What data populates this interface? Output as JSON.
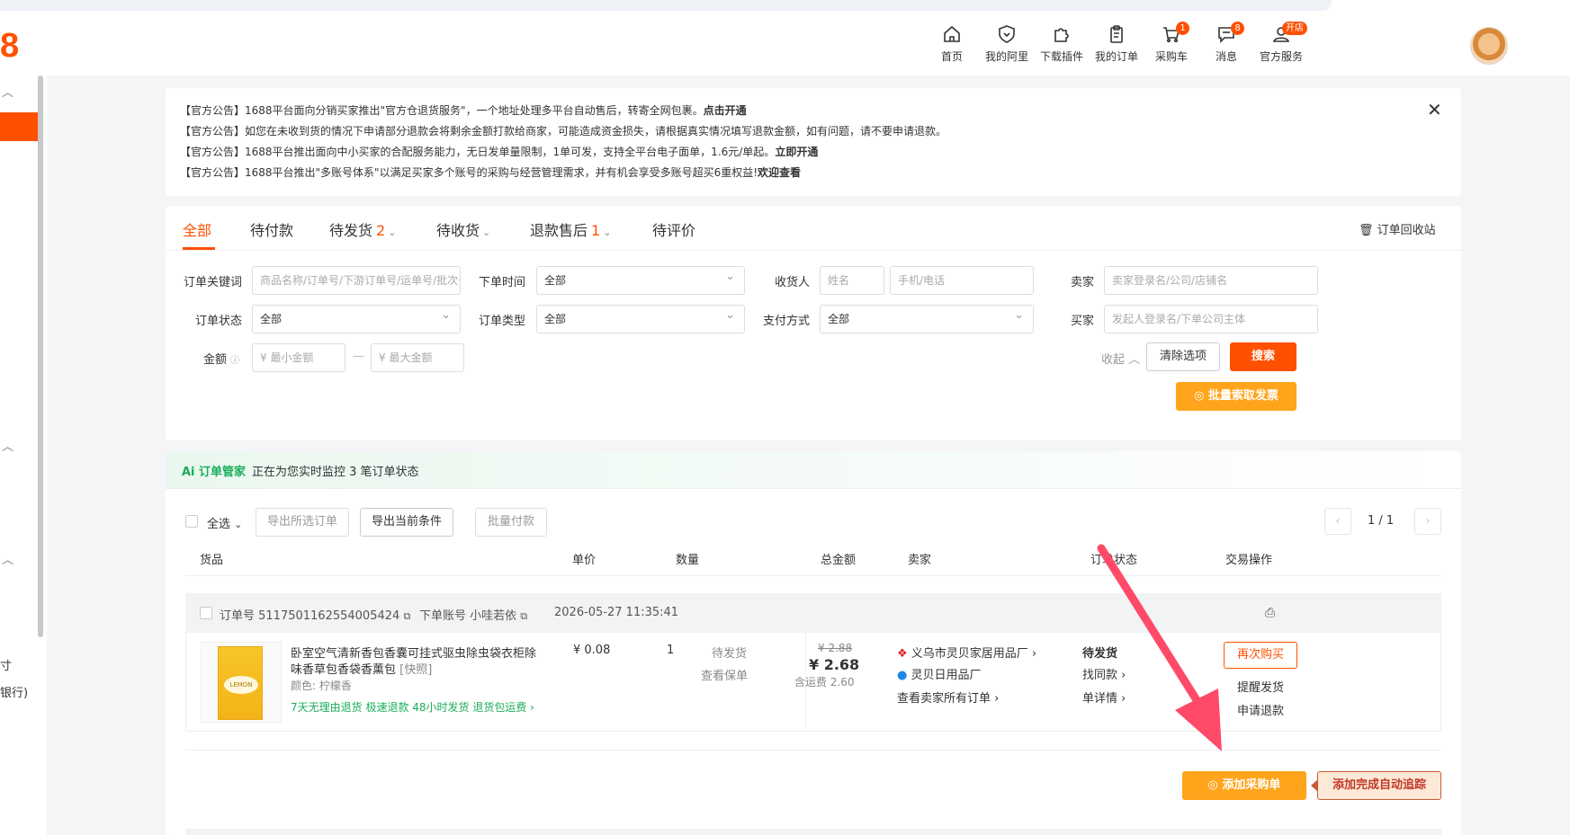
{
  "header": {
    "logo": "8",
    "nav": [
      {
        "label": "首页"
      },
      {
        "label": "我的阿里"
      },
      {
        "label": "下载插件"
      },
      {
        "label": "我的订单"
      },
      {
        "label": "采购车",
        "badge": "1"
      },
      {
        "label": "消息",
        "badge": "8"
      },
      {
        "label": "官方服务",
        "badge": "开店"
      }
    ]
  },
  "sidebar": {
    "texts": [
      "寸",
      "银行)"
    ]
  },
  "notice": {
    "lines": [
      {
        "text": "【官方公告】1688平台面向分销买家推出\"官方仓退货服务\"，一个地址处理多平台自动售后，转寄全网包裹。",
        "link": "点击开通"
      },
      {
        "text": "【官方公告】如您在未收到货的情况下申请部分退款会将剩余金额打款给商家，可能造成资金损失，请根据真实情况填写退款金额，如有问题，请不要申请退款。",
        "link": ""
      },
      {
        "text": "【官方公告】1688平台推出面向中小买家的合配服务能力，无日发单量限制，1单可发，支持全平台电子面单，1.6元/单起。",
        "link": "立即开通"
      },
      {
        "text": "【官方公告】1688平台推出\"多账号体系\"以满足买家多个账号的采购与经营管理需求，并有机会享受多账号超买6重权益!",
        "link": "欢迎查看"
      }
    ]
  },
  "tabs": [
    {
      "label": "全部",
      "count": "",
      "chev": ""
    },
    {
      "label": "待付款",
      "count": "",
      "chev": ""
    },
    {
      "label": "待发货",
      "count": "2",
      "chev": "⌄"
    },
    {
      "label": "待收货",
      "count": "",
      "chev": "⌄"
    },
    {
      "label": "退款售后",
      "count": "1",
      "chev": "⌄"
    },
    {
      "label": "待评价",
      "count": "",
      "chev": ""
    }
  ],
  "recycle": "订单回收站",
  "filters": {
    "keyword_label": "订单关键词",
    "keyword_ph": "商品名称/订单号/下游订单号/运单号/批次号",
    "time_label": "下单时间",
    "time_value": "全部",
    "receiver_label": "收货人",
    "receiver_name_ph": "姓名",
    "receiver_phone_ph": "手机/电话",
    "seller_label": "卖家",
    "seller_ph": "卖家登录名/公司/店铺名",
    "status_label": "订单状态",
    "status_value": "全部",
    "type_label": "订单类型",
    "type_value": "全部",
    "pay_label": "支付方式",
    "pay_value": "全部",
    "buyer_label": "买家",
    "buyer_ph": "发起人登录名/下单公司主体",
    "amount_label": "金额",
    "amount_min_ph": "¥  最小金额",
    "amount_max_ph": "¥  最大金额",
    "amount_sep": "—",
    "collapse": "收起",
    "clear": "清除选项",
    "search": "搜索",
    "invoice": "批量索取发票"
  },
  "ai": {
    "logo": "Ai 订单管家",
    "text": "正在为您实时监控 3 笔订单状态"
  },
  "toolbar": {
    "select_all": "全选",
    "export_selected": "导出所选订单",
    "export_current": "导出当前条件",
    "batch_pay": "批量付款",
    "page": "1 / 1"
  },
  "columns": [
    "货品",
    "单价",
    "数量",
    "总金额",
    "卖家",
    "订单状态",
    "交易操作"
  ],
  "order": {
    "order_no": "订单号 5117501162554005424",
    "account": "下单账号 小哇若依",
    "time": "2026-05-27 11:35:41",
    "title_line1": "卧室空气清新香包香囊可挂式驱虫除虫袋衣柜除",
    "title_line2": "味香草包香袋香薰包",
    "snapshot": "[快照]",
    "spec": "颜色: 柠檬香",
    "services": "7天无理由退货   极速退款   48小时发货   退货包运费  ›",
    "thumb_text": "LEMON",
    "price": "¥ 0.08",
    "qty": "1",
    "ship_status": "待发货",
    "view_policy": "查看保单",
    "original_total": "¥ 2.88",
    "total": "¥ 2.68",
    "shipping": "含运费 2.60",
    "seller_name": "义乌市灵贝家居用品厂  ›",
    "seller_shop": "灵贝日用品厂",
    "seller_all": "查看卖家所有订单  ›",
    "status": "待发货",
    "find_similar": "找同款  ›",
    "detail": "单详情  ›",
    "rebuy": "再次购买",
    "remind": "提醒发货",
    "refund": "申请退款",
    "add_cart": "添加采购单",
    "auto_track": "添加完成自动追踪"
  }
}
